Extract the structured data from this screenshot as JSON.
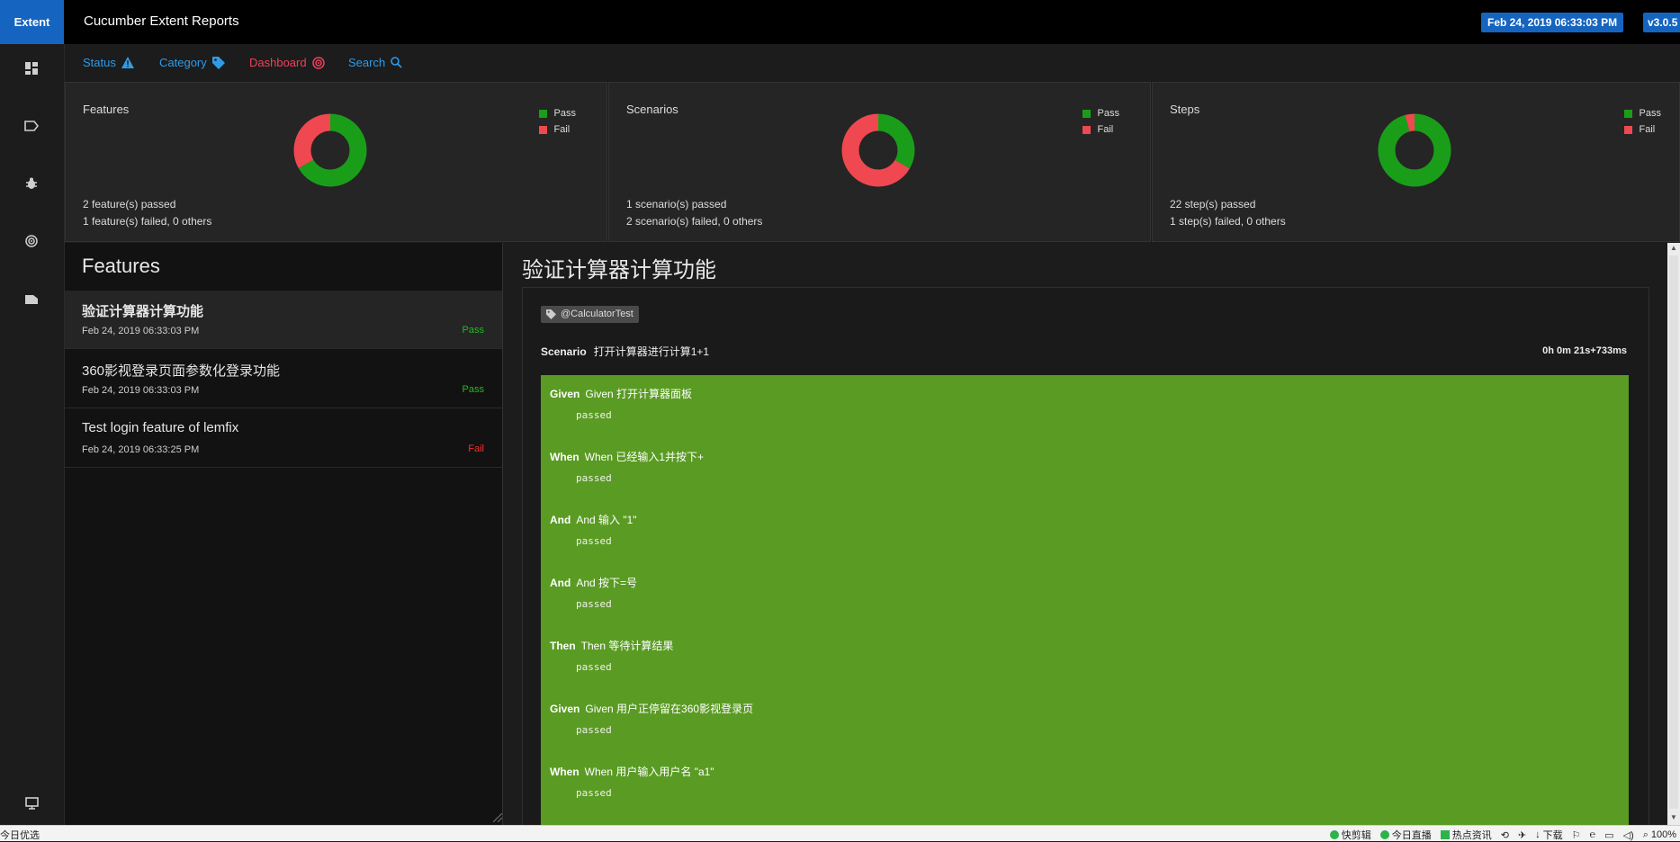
{
  "header": {
    "brand": "Extent",
    "title": "Cucumber Extent Reports",
    "date_badge": "Feb 24, 2019 06:33:03 PM",
    "version_badge": "v3.0.5"
  },
  "left_nav": {
    "icons": [
      "dashboard-icon",
      "tag-icon",
      "bug-icon",
      "radar-icon",
      "card-icon",
      "monitor-icon"
    ]
  },
  "subnav": {
    "status": "Status",
    "category": "Category",
    "dashboard": "Dashboard",
    "search": "Search"
  },
  "colors": {
    "pass": "#1a9e1a",
    "fail": "#f04850",
    "accent": "#1565c0",
    "steps_bg": "#5a9b23"
  },
  "cards": [
    {
      "title": "Features",
      "line1": "2 feature(s) passed",
      "line2": "1 feature(s) failed, 0 others",
      "pass": 2,
      "fail": 1
    },
    {
      "title": "Scenarios",
      "line1": "1 scenario(s) passed",
      "line2": "2 scenario(s) failed, 0 others",
      "pass": 1,
      "fail": 2
    },
    {
      "title": "Steps",
      "line1": "22 step(s) passed",
      "line2": "1 step(s) failed, 0 others",
      "pass": 22,
      "fail": 1
    }
  ],
  "legend": {
    "pass": "Pass",
    "fail": "Fail"
  },
  "features_panel": {
    "title": "Features",
    "items": [
      {
        "name": "验证计算器计算功能",
        "time": "Feb 24, 2019 06:33:03 PM",
        "status": "Pass"
      },
      {
        "name": "360影视登录页面参数化登录功能",
        "time": "Feb 24, 2019 06:33:03 PM",
        "status": "Pass"
      },
      {
        "name": "Test login feature of lemfix",
        "time": "Feb 24, 2019 06:33:25 PM",
        "status": "Fail"
      }
    ]
  },
  "detail": {
    "title": "验证计算器计算功能",
    "tag": "@CalculatorTest",
    "scenario_keyword": "Scenario",
    "scenario_name": "打开计算器进行计算1+1",
    "duration": "0h 0m 21s+733ms",
    "steps": [
      {
        "keyword": "Given",
        "text": "Given 打开计算器面板",
        "status": "passed"
      },
      {
        "keyword": "When",
        "text": "When 已经输入1并按下+",
        "status": "passed"
      },
      {
        "keyword": "And",
        "text": "And 输入 \"1\"",
        "status": "passed"
      },
      {
        "keyword": "And",
        "text": "And 按下=号",
        "status": "passed"
      },
      {
        "keyword": "Then",
        "text": "Then 等待计算结果",
        "status": "passed"
      },
      {
        "keyword": "Given",
        "text": "Given 用户正停留在360影视登录页",
        "status": "passed"
      },
      {
        "keyword": "When",
        "text": "When 用户输入用户名 \"a1\"",
        "status": "passed"
      }
    ]
  },
  "statusbar": {
    "left": "今日优选",
    "items": [
      "快剪辑",
      "今日直播",
      "热点资讯",
      "下载",
      "100%"
    ]
  }
}
